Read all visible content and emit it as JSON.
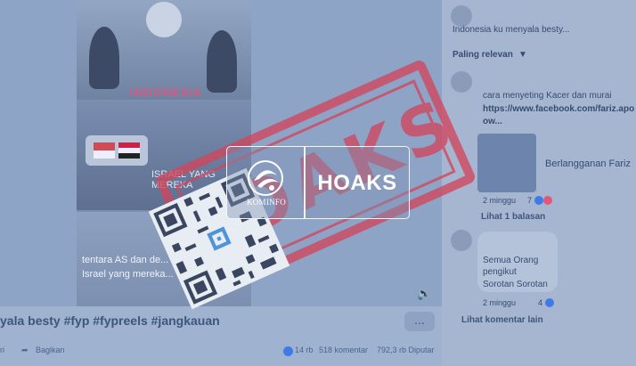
{
  "video": {
    "banner_text": "INDONESIA",
    "overlay_text": "ISRAEL YANG MEREKA",
    "caption_line1": "tentara AS dan de...",
    "caption_line2": "Israel yang mereka..."
  },
  "post": {
    "caption": "yala besty #fyp #fypreels #jangkauan",
    "more_label": "...",
    "share_label": "Bagikan",
    "reactions_count": "14 rb",
    "comments_count": "518 komentar",
    "views_count": "792,3 rb Diputar"
  },
  "comments": {
    "top_snippet": "Indonesia ku menyala besty...",
    "sort_label": "Paling relevan",
    "items": [
      {
        "line1": "cara menyeting Kacer dan murai",
        "link": "https://www.facebook.com/fariz.apo",
        "link_tail": "ow...",
        "card_title": "Berlangganan Fariz",
        "time": "2 minggu",
        "react_count": "7",
        "reply_link": "Lihat 1 balasan"
      },
      {
        "line1": "Semua Orang",
        "line2": "pengikut",
        "line3": "Sorotan Sorotan",
        "time": "2 minggu",
        "react_count": "4"
      }
    ],
    "more_comments": "Lihat komentar lain"
  },
  "badge": {
    "org_label": "KOMINFO",
    "hoax_label": "HOAKS"
  },
  "stamp": {
    "text": "HOAKS"
  },
  "colors": {
    "stamp_red": "#d1465c",
    "overlay_blue": "#9fb2cf",
    "badge_white": "#ffffff"
  }
}
